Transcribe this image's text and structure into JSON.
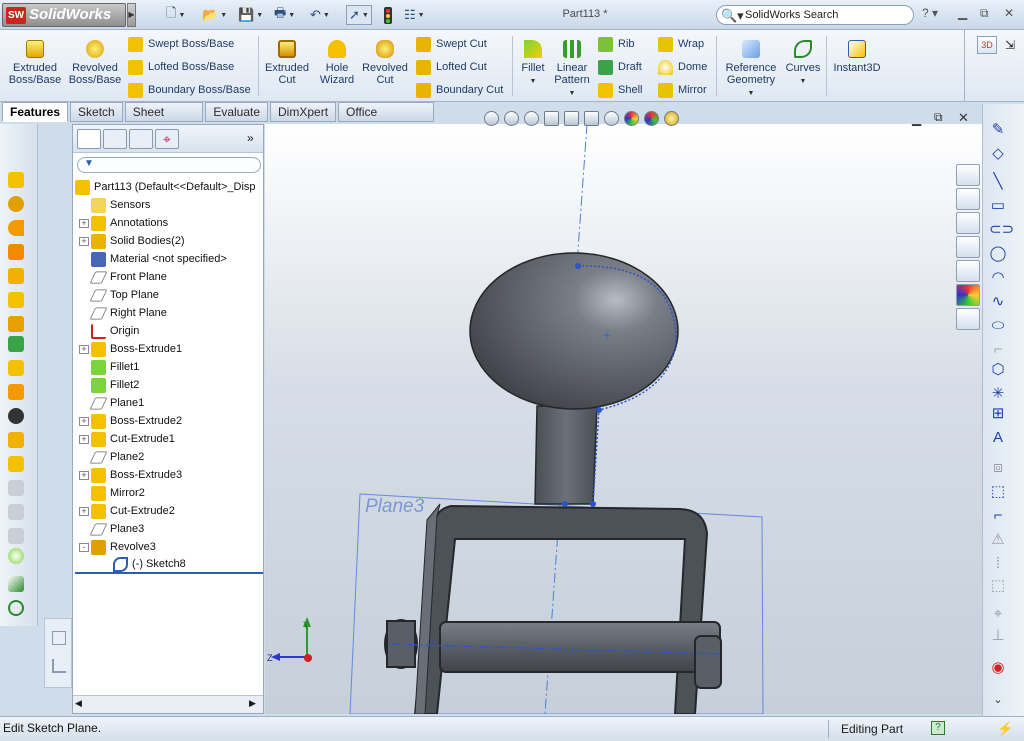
{
  "app": {
    "logo": "SolidWorks",
    "logo_mark": "SW",
    "document_title": "Part113 *"
  },
  "search": {
    "value": "SolidWorks Search"
  },
  "command_manager": {
    "extruded_boss": "Extruded Boss/Base",
    "revolved_boss": "Revolved Boss/Base",
    "swept_boss": "Swept Boss/Base",
    "lofted_boss": "Lofted Boss/Base",
    "boundary_boss": "Boundary Boss/Base",
    "extruded_cut": "Extruded Cut",
    "hole_wizard": "Hole Wizard",
    "revolved_cut": "Revolved Cut",
    "swept_cut": "Swept Cut",
    "lofted_cut": "Lofted Cut",
    "boundary_cut": "Boundary Cut",
    "fillet": "Fillet",
    "linear_pattern": "Linear Pattern",
    "rib": "Rib",
    "draft": "Draft",
    "shell": "Shell",
    "wrap": "Wrap",
    "dome": "Dome",
    "mirror": "Mirror",
    "reference_geometry": "Reference Geometry",
    "curves": "Curves",
    "instant3d": "Instant3D"
  },
  "tabs": [
    "Features",
    "Sketch",
    "Sheet Metal",
    "Evaluate",
    "DimXpert",
    "Office Products"
  ],
  "active_tab": "Features",
  "feature_tree": [
    {
      "label": "Part113  (Default<<Default>_Disp",
      "icon": "part-icon",
      "exp": "",
      "indent": 0
    },
    {
      "label": "Sensors",
      "icon": "sensor-icon",
      "exp": "",
      "indent": 1
    },
    {
      "label": "Annotations",
      "icon": "annotation-icon",
      "exp": "+",
      "indent": 1
    },
    {
      "label": "Solid Bodies(2)",
      "icon": "solid-bodies-icon",
      "exp": "+",
      "indent": 1
    },
    {
      "label": "Material <not specified>",
      "icon": "material-icon",
      "exp": "",
      "indent": 1
    },
    {
      "label": "Front Plane",
      "icon": "plane-icon",
      "exp": "",
      "indent": 1
    },
    {
      "label": "Top Plane",
      "icon": "plane-icon",
      "exp": "",
      "indent": 1
    },
    {
      "label": "Right Plane",
      "icon": "plane-icon",
      "exp": "",
      "indent": 1
    },
    {
      "label": "Origin",
      "icon": "origin-icon",
      "exp": "",
      "indent": 1
    },
    {
      "label": "Boss-Extrude1",
      "icon": "boss-extrude-icon",
      "exp": "+",
      "indent": 1
    },
    {
      "label": "Fillet1",
      "icon": "fillet-icon",
      "exp": "",
      "indent": 1
    },
    {
      "label": "Fillet2",
      "icon": "fillet-icon",
      "exp": "",
      "indent": 1
    },
    {
      "label": "Plane1",
      "icon": "plane-icon",
      "exp": "",
      "indent": 1
    },
    {
      "label": "Boss-Extrude2",
      "icon": "boss-extrude-icon",
      "exp": "+",
      "indent": 1
    },
    {
      "label": "Cut-Extrude1",
      "icon": "cut-extrude-icon",
      "exp": "+",
      "indent": 1
    },
    {
      "label": "Plane2",
      "icon": "plane-icon",
      "exp": "",
      "indent": 1
    },
    {
      "label": "Boss-Extrude3",
      "icon": "boss-extrude-icon",
      "exp": "+",
      "indent": 1
    },
    {
      "label": "Mirror2",
      "icon": "mirror-icon",
      "exp": "",
      "indent": 1
    },
    {
      "label": "Cut-Extrude2",
      "icon": "cut-extrude-icon",
      "exp": "+",
      "indent": 1
    },
    {
      "label": "Plane3",
      "icon": "plane-icon",
      "exp": "",
      "indent": 1
    },
    {
      "label": "Revolve3",
      "icon": "revolve-icon",
      "exp": "-",
      "indent": 1
    },
    {
      "label": "(-) Sketch8",
      "icon": "sketch-icon",
      "exp": "",
      "indent": 2
    }
  ],
  "viewport": {
    "plane_label": "Plane3",
    "axis_y": "Y",
    "axis_z": "Z"
  },
  "status": {
    "left": "Edit Sketch Plane.",
    "right": "Editing Part"
  },
  "colors": {
    "accent": "#2b5fa8",
    "model": "#5d6168",
    "plane": "#5577cc"
  }
}
